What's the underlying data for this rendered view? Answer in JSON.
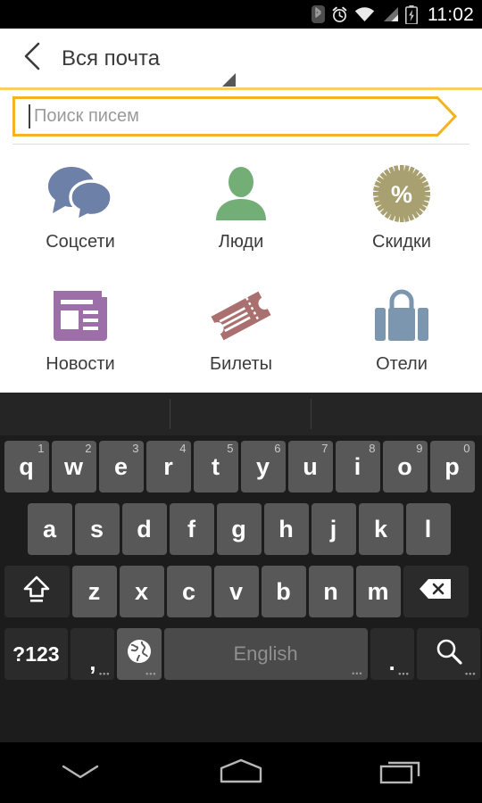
{
  "status_bar": {
    "time": "11:02",
    "icons": [
      "bluetooth-icon",
      "alarm-icon",
      "wifi-icon",
      "signal-icon",
      "battery-charging-icon"
    ]
  },
  "action_bar": {
    "back_icon": "back-chevron-icon",
    "title": "Вся почта"
  },
  "search": {
    "placeholder": "Поиск писем",
    "value": "",
    "accent_color": "#F5B41F",
    "rule_color": "#F8CF63"
  },
  "categories": [
    {
      "label": "Соцсети",
      "icon": "chat-bubbles-icon",
      "color": "#6C80A8"
    },
    {
      "label": "Люди",
      "icon": "person-icon",
      "color": "#74AE77"
    },
    {
      "label": "Скидки",
      "icon": "discount-badge-icon",
      "color": "#A8A071"
    },
    {
      "label": "Новости",
      "icon": "newspaper-icon",
      "color": "#9C6FA8"
    },
    {
      "label": "Билеты",
      "icon": "ticket-icon",
      "color": "#A9706F"
    },
    {
      "label": "Отели",
      "icon": "suitcase-icon",
      "color": "#7D96B0"
    }
  ],
  "keyboard": {
    "suggestions": [
      "",
      "",
      ""
    ],
    "row1": [
      {
        "label": "q",
        "hint": "1"
      },
      {
        "label": "w",
        "hint": "2"
      },
      {
        "label": "e",
        "hint": "3"
      },
      {
        "label": "r",
        "hint": "4"
      },
      {
        "label": "t",
        "hint": "5"
      },
      {
        "label": "y",
        "hint": "6"
      },
      {
        "label": "u",
        "hint": "7"
      },
      {
        "label": "i",
        "hint": "8"
      },
      {
        "label": "o",
        "hint": "9"
      },
      {
        "label": "p",
        "hint": "0"
      }
    ],
    "row2": [
      {
        "label": "a"
      },
      {
        "label": "s"
      },
      {
        "label": "d"
      },
      {
        "label": "f"
      },
      {
        "label": "g"
      },
      {
        "label": "h"
      },
      {
        "label": "j"
      },
      {
        "label": "k"
      },
      {
        "label": "l"
      }
    ],
    "row3": [
      {
        "label": "z"
      },
      {
        "label": "x"
      },
      {
        "label": "c"
      },
      {
        "label": "v"
      },
      {
        "label": "b"
      },
      {
        "label": "n"
      },
      {
        "label": "m"
      }
    ],
    "shift_icon": "shift-icon",
    "backspace_icon": "backspace-icon",
    "symbols_label": "?123",
    "comma_label": ",",
    "globe_icon": "globe-icon",
    "space_label": "English",
    "period_label": ".",
    "search_icon": "search-icon"
  },
  "nav_bar": {
    "back_icon": "hide-keyboard-chevron-icon",
    "home_icon": "home-icon",
    "recents_icon": "recents-icon"
  }
}
